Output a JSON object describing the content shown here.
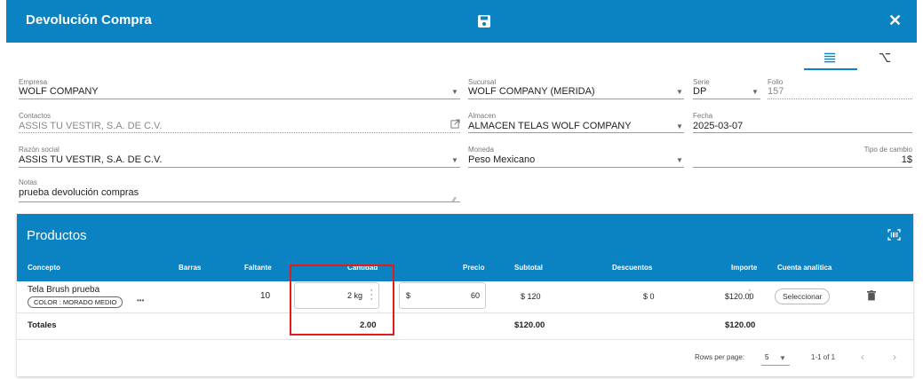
{
  "header": {
    "title": "Devolución Compra",
    "save_icon": "save-icon",
    "close_icon": "close-icon"
  },
  "tabs": [
    {
      "icon": "list-lines-icon",
      "active": true
    },
    {
      "icon": "branch-merge-icon",
      "active": false
    }
  ],
  "form": {
    "empresa": {
      "label": "Empresa",
      "value": "WOLF COMPANY"
    },
    "sucursal": {
      "label": "Sucursal",
      "value": "WOLF COMPANY (MERIDA)"
    },
    "serie": {
      "label": "Serie",
      "value": "DP"
    },
    "folio": {
      "label": "Folio",
      "value": "157"
    },
    "contactos": {
      "label": "Contactos",
      "value": "ASSIS TU VESTIR, S.A. DE C.V."
    },
    "almacen": {
      "label": "Almacen",
      "value": "ALMACEN TELAS WOLF COMPANY"
    },
    "fecha": {
      "label": "Fecha",
      "value": "2025-03-07"
    },
    "razon_social": {
      "label": "Razón social",
      "value": "ASSIS TU VESTIR, S.A. DE C.V."
    },
    "moneda": {
      "label": "Moneda",
      "value": "Peso Mexicano"
    },
    "tipo_cambio": {
      "label": "Tipo de cambio",
      "value": "1$"
    },
    "notas": {
      "label": "Notas",
      "value": "prueba devolución compras"
    }
  },
  "productos": {
    "title": "Productos",
    "columns": {
      "concepto": "Concepto",
      "barras": "Barras",
      "faltante": "Faltante",
      "cantidad": "Cantidad",
      "precio": "Precio",
      "subtotal": "Subtotal",
      "descuentos": "Descuentos",
      "importe": "Importe",
      "cuenta": "Cuenta analitica"
    },
    "row": {
      "concepto": "Tela Brush prueba",
      "chip": "COLOR : MORADO MEDIO",
      "more": "•••",
      "faltante": "10",
      "cantidad": "2 kg",
      "precio_prefix": "$",
      "precio": "60",
      "subtotal": "$ 120",
      "descuentos": "$ 0",
      "importe": "$120.00",
      "cuenta_button": "Seleccionar"
    },
    "totals": {
      "label": "Totales",
      "cantidad": "2.00",
      "subtotal": "$120.00",
      "importe": "$120.00"
    },
    "footer": {
      "rows_label": "Rows per page:",
      "rows_value": "5",
      "range": "1-1 of 1"
    }
  },
  "colors": {
    "primary": "#0b82c1",
    "highlight": "#e21b1b"
  }
}
